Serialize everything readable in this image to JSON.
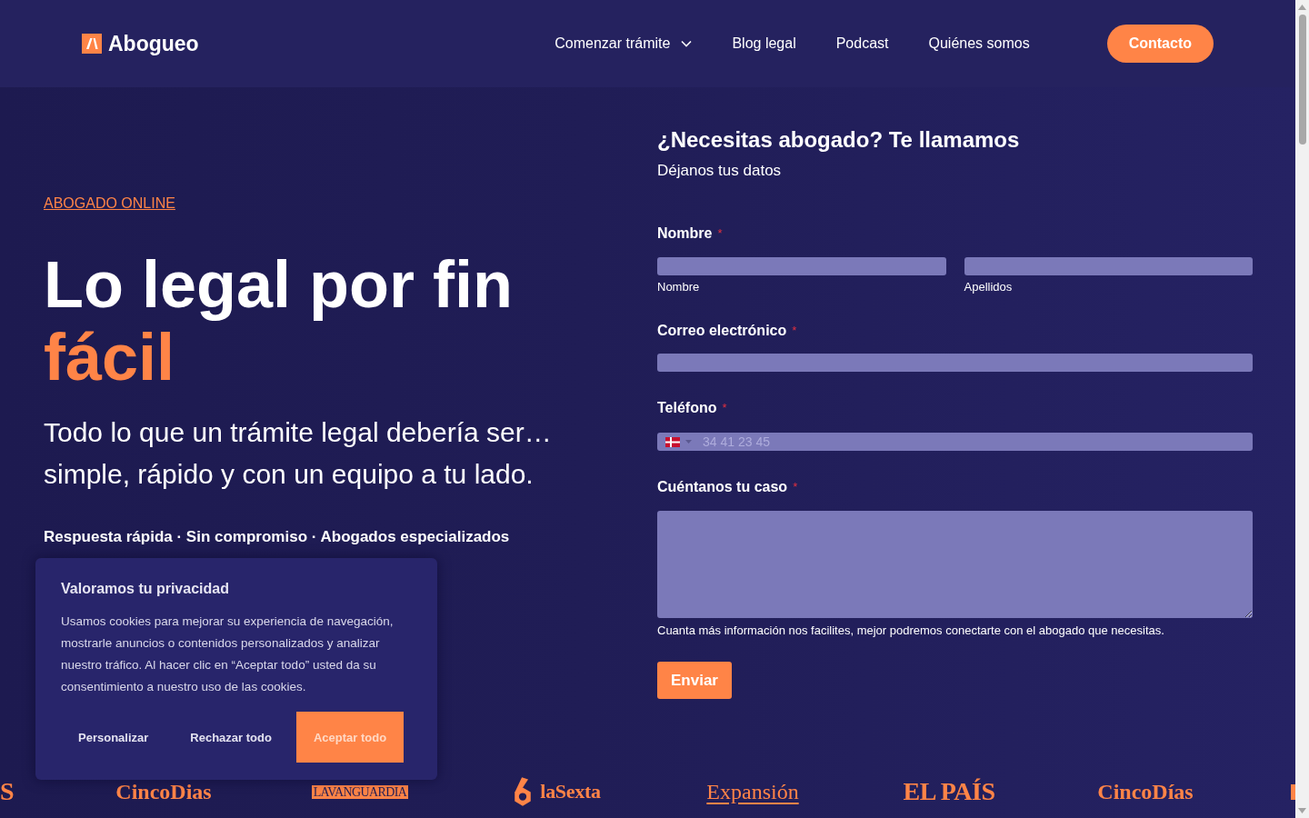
{
  "header": {
    "logo": "Abogueo",
    "nav": [
      {
        "label": "Comenzar trámite",
        "has_menu": true
      },
      {
        "label": "Blog legal",
        "has_menu": false
      },
      {
        "label": "Podcast",
        "has_menu": false
      },
      {
        "label": "Quiénes somos",
        "has_menu": false
      }
    ],
    "cta": "Contacto"
  },
  "hero": {
    "eyebrow": "ABOGADO ONLINE",
    "title": "Lo legal por fin",
    "title_accent": "fácil",
    "subtitle": "Todo lo que un trámite legal debería ser… simple, rápido y con un equipo a tu lado.",
    "tagline": "Respuesta rápida · Sin compromiso · Abogados especializados"
  },
  "form": {
    "title": "¿Necesitas abogado? Te llamamos",
    "subtitle": "Déjanos tus datos",
    "fields": [
      {
        "kind": "name",
        "label": "Nombre",
        "required_mark": "*",
        "parts": [
          {
            "sublabel": "Nombre"
          },
          {
            "sublabel": "Apellidos"
          }
        ]
      },
      {
        "kind": "text",
        "label": "Correo electrónico",
        "required_mark": "*"
      },
      {
        "kind": "phone",
        "label": "Teléfono",
        "required_mark": "*",
        "placeholder": "34 41 23 45"
      },
      {
        "kind": "textarea",
        "label": "Cuéntanos tu caso",
        "required_mark": "*",
        "help": "Cuanta más información nos facilites, mejor podremos conectarte con el abogado que necesitas."
      }
    ],
    "submit": "Enviar"
  },
  "cookie_banner": {
    "title": "Valoramos tu privacidad",
    "text": "Usamos cookies para mejorar su experiencia de navegación, mostrarle anuncios o contenidos personalizados y analizar nuestro tráfico. Al hacer clic en “Aceptar todo” usted da su consentimiento a nuestro uso de las cookies.",
    "buttons": [
      {
        "label": "Personalizar",
        "kind": "text"
      },
      {
        "label": "Rechazar todo",
        "kind": "text"
      },
      {
        "label": "Aceptar todo",
        "kind": "primary"
      }
    ]
  },
  "press_logos": [
    {
      "kind": "serif-large",
      "text": "S"
    },
    {
      "kind": "serif",
      "text": "CincoDias"
    },
    {
      "kind": "boxed",
      "text": "LAVANGUARDIA"
    },
    {
      "kind": "mark",
      "text": "laSexta"
    },
    {
      "kind": "underlined",
      "text": "Expansión"
    },
    {
      "kind": "serif-large",
      "text": "EL PAÍS"
    },
    {
      "kind": "serif",
      "text": "CincoDías"
    },
    {
      "kind": "fragment"
    }
  ]
}
